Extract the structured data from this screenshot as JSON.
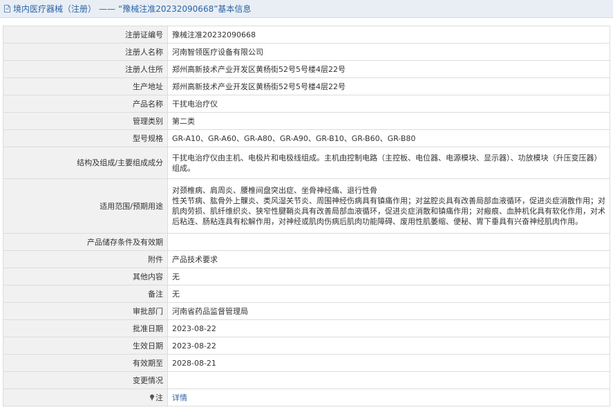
{
  "header": {
    "section": "境内医疗器械（注册）",
    "dash": "——",
    "title": "“豫械注准20232090668”基本信息"
  },
  "fields": {
    "reg_no": {
      "label": "注册证编号",
      "value": "豫械注准20232090668"
    },
    "registrant": {
      "label": "注册人名称",
      "value": "河南智领医疗设备有限公司"
    },
    "registrant_addr": {
      "label": "注册人住所",
      "value": "郑州高新技术产业开发区黄杨街52号5号楼4层22号"
    },
    "production_addr": {
      "label": "生产地址",
      "value": "郑州高新技术产业开发区黄杨街52号5号楼4层22号"
    },
    "product_name": {
      "label": "产品名称",
      "value": "干扰电治疗仪"
    },
    "mgmt_class": {
      "label": "管理类别",
      "value": "第二类"
    },
    "model": {
      "label": "型号规格",
      "value": "GR-A10、GR-A60、GR-A80、GR-A90、GR-B10、GR-B60、GR-B80"
    },
    "structure": {
      "label": "结构及组成/主要组成成分",
      "value": "干扰电治疗仪由主机、电极片和电极线组成。主机由控制电路（主控板、电位器、电源模块、显示器）、功放模块（升压变压器）组成。"
    },
    "usage": {
      "label": "适用范围/预期用途",
      "line1": "对颈椎病、肩周炎、腰椎间盘突出症、坐骨神经痛、退行性骨",
      "line2": "性关节病、肱骨外上髁炎、类风湿关节炎、周围神经伤病具有镇痛作用；对盆腔炎具有改善局部血液循环，促进炎症消散作用；对肌肉劳损、肌纤维织炎、狭窄性腱鞘炎具有改善局部血液循环，促进炎症消散和镇痛作用；对瘢痕、血肿机化具有软化作用，对术后粘连、肠粘连具有松解作用，对神经或肌肉伤病后肌肉功能障碍、废用性肌萎缩、便秘、胃下垂具有兴奋神经肌肉作用。"
    },
    "storage": {
      "label": "产品储存条件及有效期",
      "value": ""
    },
    "attachment": {
      "label": "附件",
      "value": "产品技术要求"
    },
    "other": {
      "label": "其他内容",
      "value": "无"
    },
    "remark": {
      "label": "备注",
      "value": "无"
    },
    "approval_dept": {
      "label": "审批部门",
      "value": "河南省药品监督管理局"
    },
    "approval_date": {
      "label": "批准日期",
      "value": "2023-08-22"
    },
    "effective_date": {
      "label": "生效日期",
      "value": "2023-08-22"
    },
    "valid_until": {
      "label": "有效期至",
      "value": "2028-08-21"
    },
    "change": {
      "label": "变更情况",
      "value": ""
    },
    "note": {
      "label": "注",
      "link": "详情"
    }
  },
  "icons": {
    "header": "document-icon",
    "note": "pin-icon"
  },
  "colors": {
    "link": "#2b64a8",
    "header_bg": "#e9eef4",
    "label_bg": "#f1f1f1",
    "border": "#dcdcdc"
  }
}
